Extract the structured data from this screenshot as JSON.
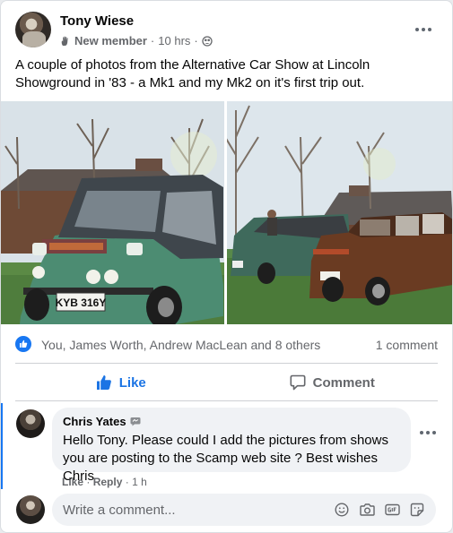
{
  "post": {
    "author": "Tony Wiese",
    "badge": "New member",
    "time": "10 hrs",
    "separator": "·",
    "text": "A couple of photos from the Alternative Car Show at Lincoln Showground in '83 - a Mk1 and my Mk2 on it's first trip out."
  },
  "photos": {
    "plate": "KYB 316Y"
  },
  "reactions": {
    "names": "You, James Worth, Andrew MacLean and 8 others",
    "comment_count": "1 comment"
  },
  "actions": {
    "like_label": "Like",
    "comment_label": "Comment"
  },
  "comment": {
    "author": "Chris Yates",
    "text": "Hello Tony. Please could I add the pictures from shows you are posting to the Scamp web site ? Best wishes Chris",
    "like_label": "Like",
    "reply_label": "Reply",
    "time": "1 h",
    "separator": "·"
  },
  "composer": {
    "placeholder": "Write a comment..."
  },
  "colors": {
    "accent": "#1877f2",
    "secondary_text": "#65676b"
  },
  "icons": [
    "hand-icon",
    "globe-icon",
    "more-dots-icon",
    "like-thumb-icon",
    "comment-icon",
    "messenger-icon",
    "emoji-icon",
    "camera-icon",
    "gif-icon",
    "sticker-icon"
  ]
}
